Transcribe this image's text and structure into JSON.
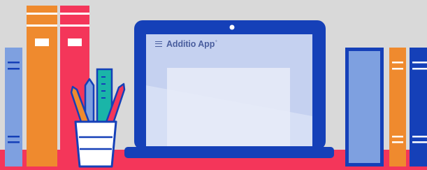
{
  "app": {
    "name": "Additio App",
    "trademark": "°"
  },
  "icons": {
    "menu": "hamburger-menu-icon"
  },
  "colors": {
    "background": "#d9d9d9",
    "shelf": "#f4365a",
    "laptop_frame": "#1540b8",
    "laptop_screen": "#c5d1f0",
    "book_orange": "#ef8a2e",
    "book_red": "#f4365a",
    "book_light_blue": "#7ea0e0",
    "book_dark_blue": "#1540b8"
  }
}
